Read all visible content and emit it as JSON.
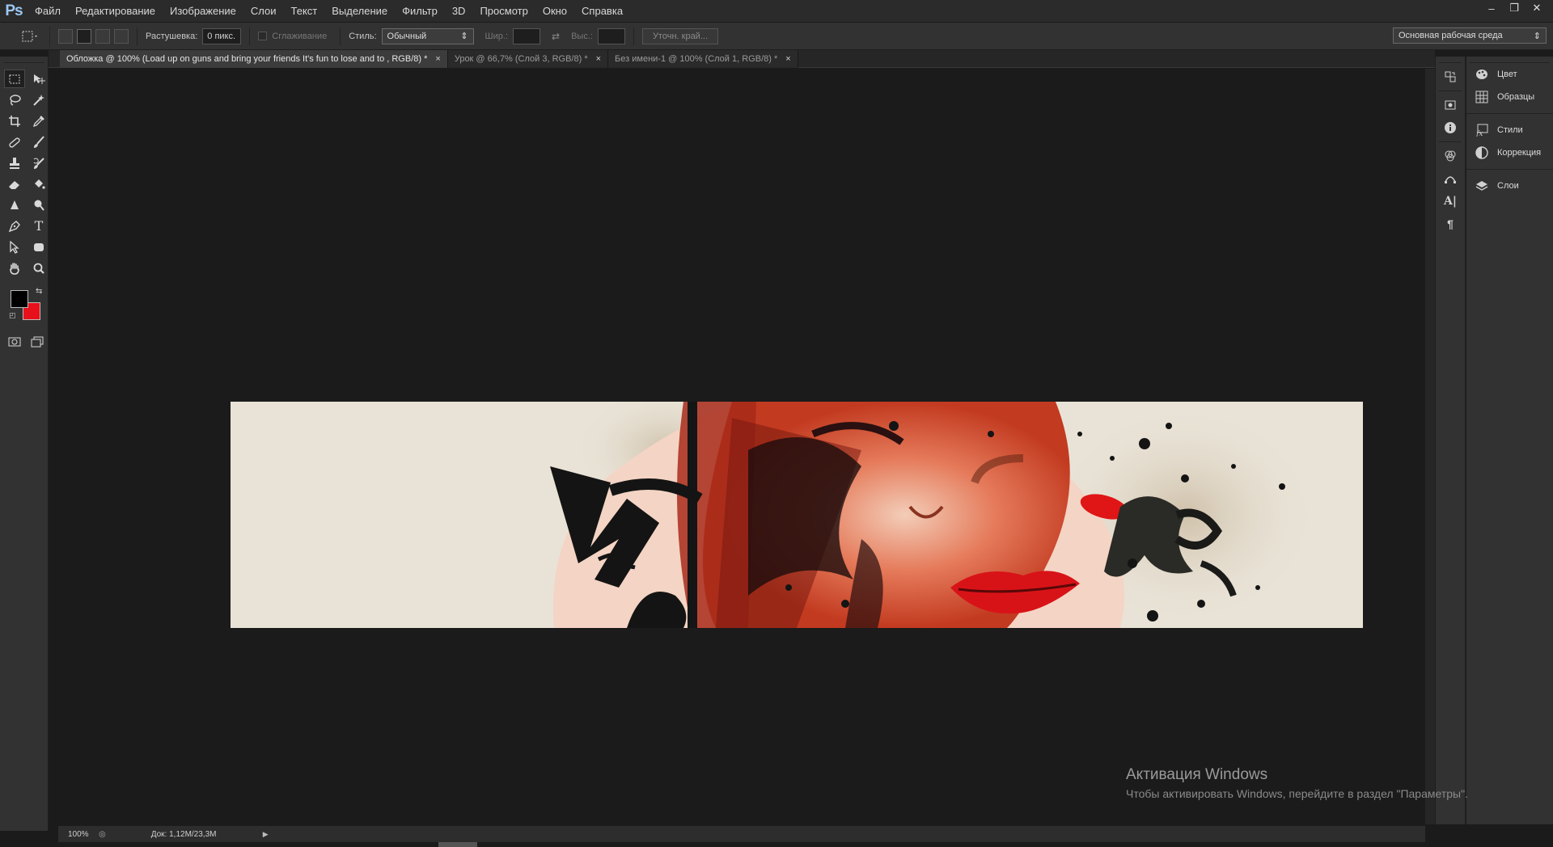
{
  "app": {
    "logo": "Ps"
  },
  "menu": [
    "Файл",
    "Редактирование",
    "Изображение",
    "Слои",
    "Текст",
    "Выделение",
    "Фильтр",
    "3D",
    "Просмотр",
    "Окно",
    "Справка"
  ],
  "window_controls": {
    "minimize": "–",
    "restore": "❐",
    "close": "✕"
  },
  "options": {
    "feather_label": "Растушевка:",
    "feather_value": "0 пикс.",
    "antialias_label": "Сглаживание",
    "style_label": "Стиль:",
    "style_value": "Обычный",
    "width_label": "Шир.:",
    "height_label": "Выс.:",
    "refine_edge": "Уточн. край...",
    "workspace": "Основная рабочая среда"
  },
  "colors": {
    "foreground": "#000000",
    "background": "#e8101a"
  },
  "tabs": [
    {
      "label": "Обложка @ 100% (Load up on guns and bring your friends It's fun to lose and to , RGB/8) *",
      "close": "×",
      "active": true
    },
    {
      "label": "Урок @ 66,7% (Слой 3, RGB/8) *",
      "close": "×",
      "active": false
    },
    {
      "label": "Без имени-1 @ 100% (Слой 1, RGB/8) *",
      "close": "×",
      "active": false
    }
  ],
  "status": {
    "zoom": "100%",
    "doc_info": "Док: 1,12M/23,3M",
    "arrow": "▶"
  },
  "strip_icons": [
    "history-icon",
    "properties-icon",
    "info-icon",
    "channels-icon",
    "paths-icon",
    "character-icon",
    "paragraph-icon"
  ],
  "dock": [
    {
      "label": "Цвет",
      "icon": "palette-icon"
    },
    {
      "label": "Образцы",
      "icon": "swatches-icon"
    },
    {
      "label": "Стили",
      "icon": "styles-icon"
    },
    {
      "label": "Коррекция",
      "icon": "adjustments-icon"
    },
    {
      "label": "Слои",
      "icon": "layers-icon"
    }
  ],
  "activation": {
    "title": "Активация Windows",
    "subtitle": "Чтобы активировать Windows, перейдите в раздел \"Параметры\"."
  }
}
